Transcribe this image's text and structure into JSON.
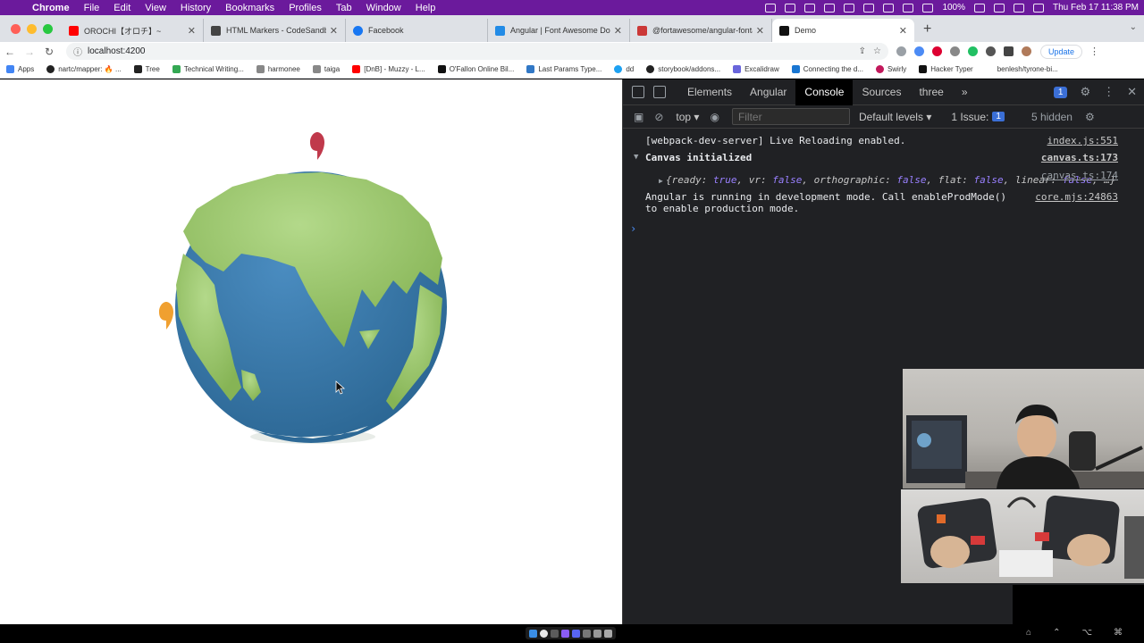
{
  "menubar": {
    "app": "Chrome",
    "items": [
      "File",
      "Edit",
      "View",
      "History",
      "Bookmarks",
      "Profiles",
      "Tab",
      "Window",
      "Help"
    ],
    "battery": "100%",
    "clock": "Thu Feb 17  11:38 PM",
    "colors": {
      "bar": "#6b1a9c"
    }
  },
  "tabs": [
    {
      "title": "OROCHI【オロチ】~",
      "favicon_color": "#ff0000"
    },
    {
      "title": "HTML Markers - CodeSandbox",
      "favicon_color": "#444444"
    },
    {
      "title": "Facebook",
      "favicon_color": "#1877f2"
    },
    {
      "title": "Angular | Font Awesome Docs",
      "favicon_color": "#228be6"
    },
    {
      "title": "@fortawesome/angular-fontaw",
      "favicon_color": "#cb3837"
    },
    {
      "title": "Demo",
      "favicon_color": "#111111"
    }
  ],
  "address": {
    "url": "localhost:4200",
    "update_label": "Update"
  },
  "bookmarks": [
    {
      "label": "Apps",
      "color": "#4285f4"
    },
    {
      "label": "nartc/mapper: 🔥 ...",
      "color": "#222222"
    },
    {
      "label": "Tree",
      "color": "#222222"
    },
    {
      "label": "Technical Writing...",
      "color": "#34a853"
    },
    {
      "label": "harmonee",
      "color": "#888888"
    },
    {
      "label": "taiga",
      "color": "#888888"
    },
    {
      "label": "[DnB] - Muzzy - L...",
      "color": "#ff0000"
    },
    {
      "label": "O'Fallon Online Bil...",
      "color": "#111111"
    },
    {
      "label": "Last Params Type...",
      "color": "#3178c6"
    },
    {
      "label": "dd",
      "color": "#1da1f2"
    },
    {
      "label": "storybook/addons...",
      "color": "#222222"
    },
    {
      "label": "Excalidraw",
      "color": "#6965db"
    },
    {
      "label": "Connecting the d...",
      "color": "#1976d2"
    },
    {
      "label": "Swirly",
      "color": "#c2185b"
    },
    {
      "label": "Hacker Typer",
      "color": "#111111"
    },
    {
      "label": "benlesh/tyrone-bi...",
      "color": "#ffffff"
    }
  ],
  "devtools": {
    "tabs": [
      "Elements",
      "Angular",
      "Console",
      "Sources",
      "three"
    ],
    "active_tab": "Console",
    "issue_badge": "1",
    "context": "top",
    "filter_placeholder": "Filter",
    "levels": "Default levels",
    "issues": "1 Issue:",
    "issues_count": "1",
    "hidden": "5 hidden",
    "console": [
      {
        "text": "[webpack-dev-server] Live Reloading enabled.",
        "source": "index.js:551"
      },
      {
        "text": "Canvas initialized",
        "source": "canvas.ts:173"
      },
      {
        "source": "canvas.ts:174"
      },
      {
        "text": "Angular is running in development mode. Call enableProdMode() to enable production mode.",
        "source": "core.mjs:24863"
      }
    ],
    "object_preview": {
      "open": "{",
      "pairs": [
        {
          "key": "ready",
          "value": "true"
        },
        {
          "key": "vr",
          "value": "false"
        },
        {
          "key": "orthographic",
          "value": "false"
        },
        {
          "key": "flat",
          "value": "false"
        },
        {
          "key": "linear",
          "value": "false"
        }
      ],
      "ellipsis": "…}"
    }
  },
  "scene": {
    "colors": {
      "land": "#9cc86a",
      "ocean": "#3a78a8",
      "marker_red": "#c0394b",
      "marker_orange": "#f0a030"
    }
  }
}
